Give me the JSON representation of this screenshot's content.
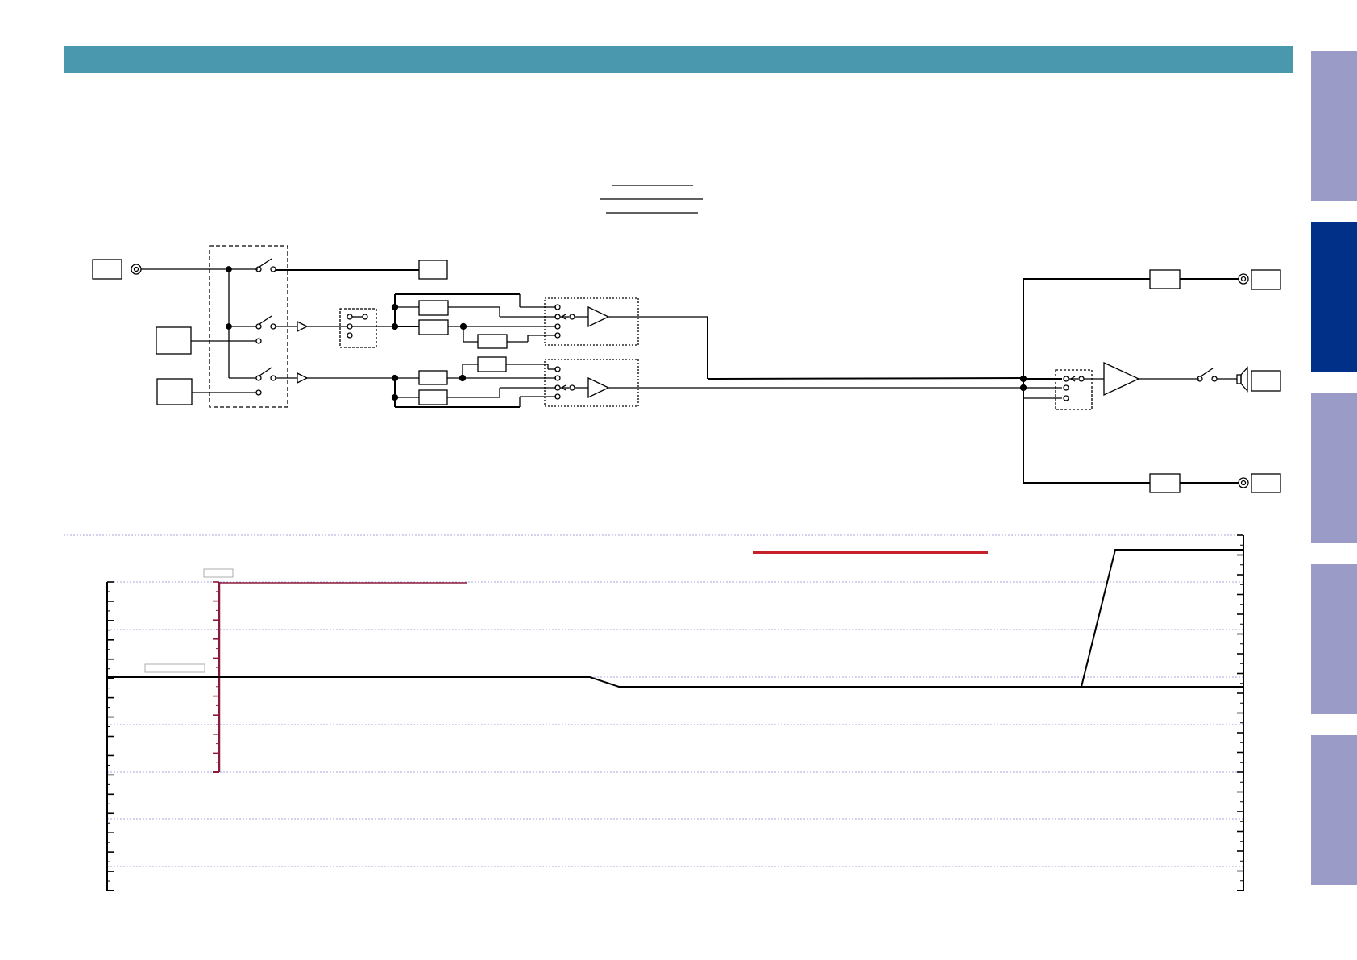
{
  "colors": {
    "header_bar": "#4a98ad",
    "tab_inactive": "#9b9bc7",
    "tab_active": "#003087",
    "signal_line": "#000000",
    "level_accent": "#c8202a",
    "level_marker": "#8b1a3a",
    "grid_line": "#8a8ad0"
  },
  "header": {
    "title": ""
  },
  "side_tabs": [
    {
      "label": "",
      "active": false
    },
    {
      "label": "",
      "active": true
    },
    {
      "label": "",
      "active": false
    },
    {
      "label": "",
      "active": false
    },
    {
      "label": "",
      "active": false
    }
  ],
  "block_diagram": {
    "title_lines": [
      "",
      "",
      ""
    ],
    "input_labels": [
      "",
      "",
      ""
    ],
    "output_labels": [
      "",
      "",
      ""
    ],
    "icons": [
      "jack-icon",
      "switch-icon",
      "buffer-amp-icon",
      "selector-icon",
      "speaker-icon"
    ]
  },
  "level_chart": {
    "annotation_labels": [
      "",
      ""
    ],
    "axis_ticks_left": 32,
    "axis_ticks_right": 36
  }
}
